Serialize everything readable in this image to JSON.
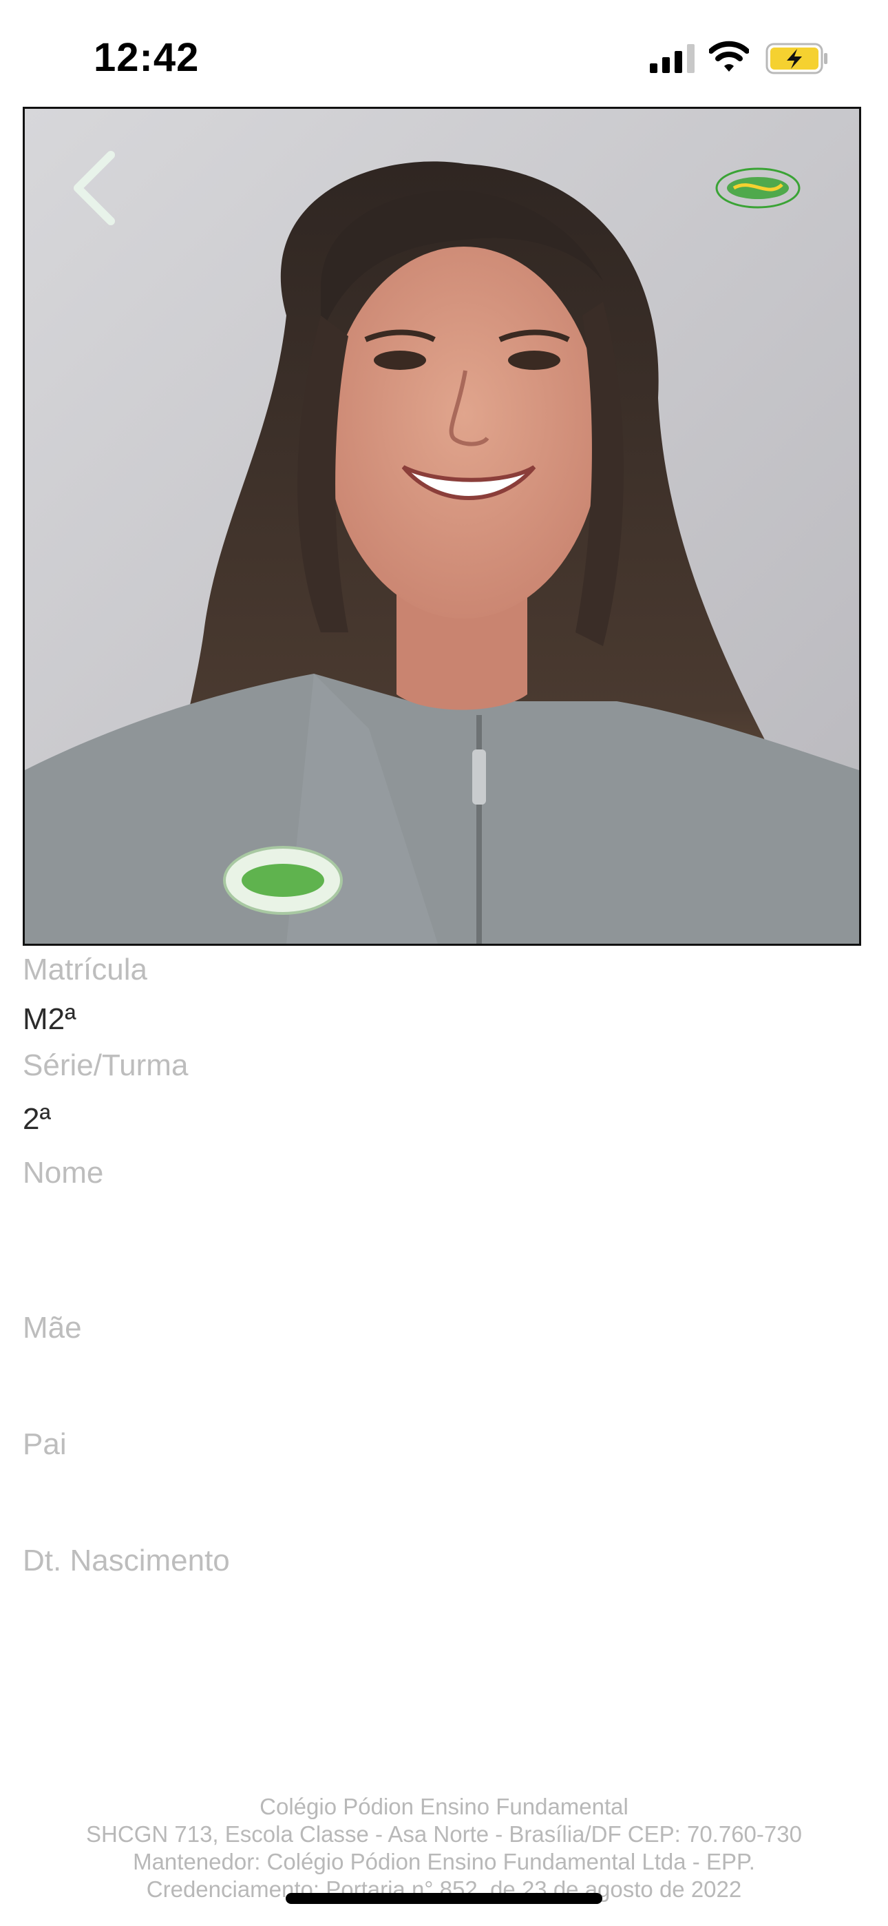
{
  "status_bar": {
    "time": "12:42",
    "signal_icon": "cellular-signal-icon",
    "wifi_icon": "wifi-icon",
    "battery_icon": "battery-charging-icon",
    "battery_color": "#f5d130"
  },
  "photo_card": {
    "back_icon": "chevron-left-icon",
    "logo_icon": "podion-logo-icon",
    "logo_color": "#3aa335"
  },
  "fields": {
    "matricula_label": "Matrícula",
    "matricula_value": "M2ª",
    "serie_label": "Série/Turma",
    "serie_value": "2ª",
    "nome_label": "Nome",
    "mae_label": "Mãe",
    "pai_label": "Pai",
    "nascimento_label": "Dt. Nascimento"
  },
  "footer": {
    "line1": "Colégio Pódion Ensino Fundamental",
    "line2": "SHCGN 713, Escola Classe - Asa Norte - Brasília/DF CEP: 70.760-730",
    "line3": "Mantenedor:  Colégio Pódion Ensino Fundamental Ltda - EPP.",
    "line4": "Credenciamento: Portaria n° 852, de 23 de agosto de 2022"
  }
}
